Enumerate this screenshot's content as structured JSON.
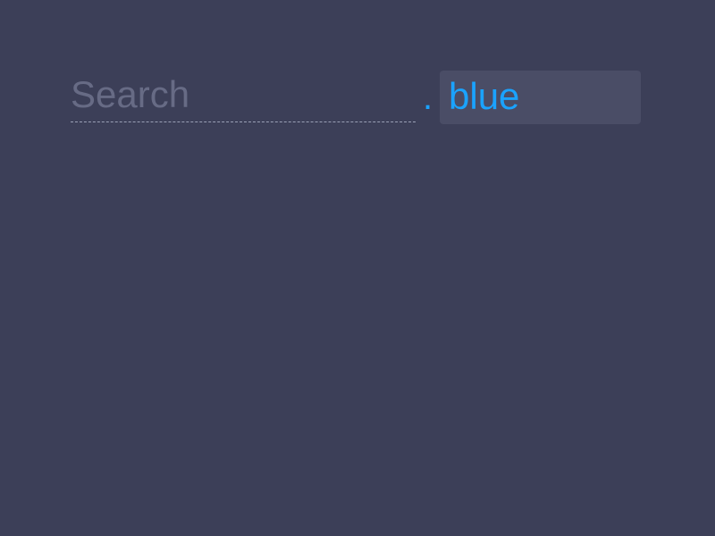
{
  "search": {
    "placeholder": "Search",
    "value": ""
  },
  "selector": {
    "prefix": ".",
    "value": "blue"
  },
  "colors": {
    "background": "#3c3f58",
    "accent": "#1aa3ff",
    "selector_background": "#4a4d66",
    "placeholder": "#676b85"
  }
}
